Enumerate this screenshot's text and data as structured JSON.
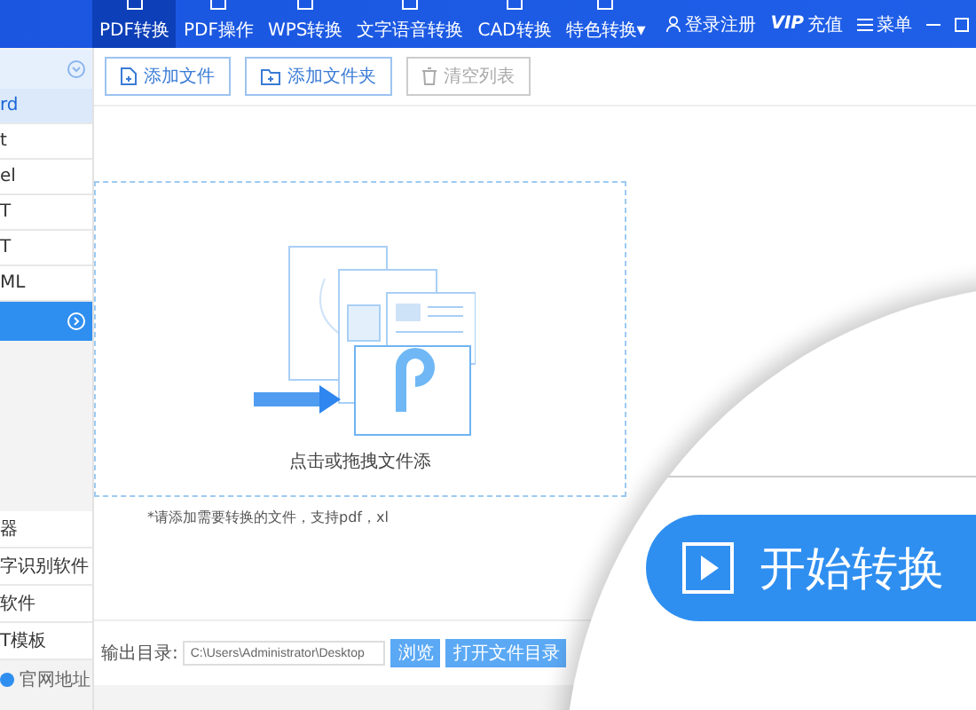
{
  "tabs": [
    {
      "label": "PDF转换",
      "selected": true
    },
    {
      "label": "PDF操作",
      "selected": false
    },
    {
      "label": "WPS转换",
      "selected": false
    },
    {
      "label": "文字语音转换",
      "selected": false
    },
    {
      "label": "CAD转换",
      "selected": false
    },
    {
      "label": "特色转换",
      "selected": false,
      "dropdown": true,
      "caret": "▾"
    }
  ],
  "header_actions": [
    {
      "kind": "user",
      "label": "登录注册"
    },
    {
      "kind": "vip",
      "label": "VIP",
      "sub": "充值"
    },
    {
      "kind": "menu",
      "label": "菜单"
    }
  ],
  "sidebar": {
    "items": [
      {
        "label": "rd",
        "selected": true
      },
      {
        "label": "t",
        "selected": false
      },
      {
        "label": "el",
        "selected": false
      },
      {
        "label": "T",
        "selected": false
      },
      {
        "label": "T",
        "selected": false
      },
      {
        "label": "ML",
        "selected": false
      }
    ],
    "links": [
      {
        "label": "器"
      },
      {
        "label": "字识别软件"
      },
      {
        "label": "软件"
      },
      {
        "label": "T模板"
      }
    ],
    "website": {
      "label": "官网地址"
    }
  },
  "toolbar": [
    {
      "kind": "file",
      "label": "添加文件",
      "disabled": false
    },
    {
      "kind": "folder",
      "label": "添加文件夹",
      "disabled": false
    },
    {
      "kind": "trash",
      "label": "清空列表",
      "disabled": true
    }
  ],
  "drop_zone": {
    "text": "点击或拖拽文件添"
  },
  "hint": "*请添加需要转换的文件，支持pdf，xl",
  "output": {
    "label": "输出目录:",
    "path": "C:\\Users\\Administrator\\Desktop",
    "browse": "浏览",
    "open_folder": "打开文件目录"
  },
  "start_button": {
    "label": "开始转换"
  }
}
